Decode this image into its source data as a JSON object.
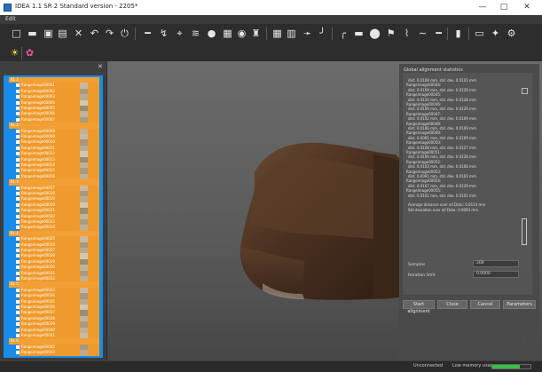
{
  "window": {
    "title": "IDEA 1.1 SR 2 Standard version - 2205*",
    "minimize": "—",
    "maximize": "□",
    "close": "✕"
  },
  "menu": {
    "file": "Edit"
  },
  "toolbar1_icons": [
    "new-icon",
    "open-icon",
    "save-icon",
    "save-as-icon",
    "delete-icon",
    "undo-icon",
    "redo-icon",
    "power-icon",
    "measure-icon",
    "graph-icon",
    "fit-icon",
    "settings-icon",
    "points-icon",
    "cube-icon",
    "sphere-icon",
    "marker-icon",
    "grid-icon",
    "transform-icon",
    "arrow-icon",
    "line-icon",
    "curve-icon",
    "rect-icon",
    "ellipse-icon",
    "flag-icon",
    "polyline-icon",
    "brush-icon",
    "ruler-icon",
    "panel-icon",
    "window-icon",
    "star-icon",
    "gear-icon"
  ],
  "toolbar2_icons": [
    "light-icon",
    "palette-icon"
  ],
  "tree": {
    "groups": [
      {
        "label": "RL 1",
        "items": [
          "Rangeimage00001",
          "Rangeimage00002",
          "Rangeimage00003",
          "Rangeimage00004",
          "Rangeimage00005",
          "Rangeimage00006",
          "Rangeimage00007"
        ]
      },
      {
        "label": "RL 2",
        "items": [
          "Rangeimage00008",
          "Rangeimage00009",
          "Rangeimage00010",
          "Rangeimage00011",
          "Rangeimage00012",
          "Rangeimage00013",
          "Rangeimage00014",
          "Rangeimage00015",
          "Rangeimage00016"
        ]
      },
      {
        "label": "RL 3",
        "items": [
          "Rangeimage00017",
          "Rangeimage00018",
          "Rangeimage00019",
          "Rangeimage00020",
          "Rangeimage00021",
          "Rangeimage00022",
          "Rangeimage00023",
          "Rangeimage00024"
        ]
      },
      {
        "label": "RL 4",
        "items": [
          "Rangeimage00025",
          "Rangeimage00026",
          "Rangeimage00027",
          "Rangeimage00028",
          "Rangeimage00029",
          "Rangeimage00030",
          "Rangeimage00031",
          "Rangeimage00032"
        ]
      },
      {
        "label": "RL 5",
        "items": [
          "Rangeimage00033",
          "Rangeimage00034",
          "Rangeimage00035",
          "Rangeimage00036",
          "Rangeimage00037",
          "Rangeimage00038",
          "Rangeimage00039",
          "Rangeimage00040",
          "Rangeimage00041"
        ]
      },
      {
        "label": "RL 6",
        "items": [
          "Rangeimage00042",
          "Rangeimage00043"
        ]
      }
    ],
    "swatches": [
      "#c9b9a4",
      "#a89880",
      "#b9a98f",
      "#d4c6b0",
      "#9c8c74",
      "#c1b29a",
      "#aa9a82",
      "#bfb096"
    ]
  },
  "dialog": {
    "title": "Global alignment statistics",
    "log": [
      "dist. 0.0108 mm, std. dev. 0.0101 mm",
      "Rangeimage00044:",
      "dist. 0.0109 mm, std. dev. 0.0129 mm",
      "Rangeimage00045:",
      "dist. 0.0110 mm, std. dev. 0.0128 mm",
      "Rangeimage00046:",
      "dist. 0.0109 mm, std. dev. 0.0129 mm",
      "Rangeimage00047:",
      "dist. 0.0102 mm, std. dev. 0.0109 mm",
      "Rangeimage00048:",
      "dist. 0.0106 mm, std. dev. 0.0109 mm",
      "Rangeimage00049:",
      "dist. 0.0091 mm, std. dev. 0.0109 mm",
      "Rangeimage00050:",
      "dist. 0.0108 mm, std. dev. 0.0127 mm",
      "Rangeimage00051:",
      "dist. 0.0109 mm, std. dev. 0.0128 mm",
      "Rangeimage00052:",
      "dist. 0.0103 mm, std. dev. 0.0108 mm",
      "Rangeimage00053:",
      "dist. 0.0091 mm, std. dev. 0.0101 mm",
      "Rangeimage00054:",
      "dist. 0.0107 mm, std. dev. 0.0129 mm",
      "Rangeimage00055:",
      "dist. 0.0101 mm, std. dev. 0.0101 mm",
      "",
      "Average distance over all Data: 0.0114 mm",
      "Std deviation over all Data: 0.0093 mm"
    ],
    "buttons": [
      "Start alignment",
      "Close",
      "Cancel",
      "Parameters"
    ],
    "fields": [
      {
        "label": "Samples",
        "value": "200"
      },
      {
        "label": "Iteration limit",
        "value": "0.0000"
      }
    ]
  },
  "status": {
    "left": "Unconnected",
    "memory_label": "Low memory usage",
    "memory_fraction": 0.72
  },
  "colors": {
    "accent": "#1a8be8",
    "orange": "#ef9a2c",
    "memory": "#34c244"
  }
}
